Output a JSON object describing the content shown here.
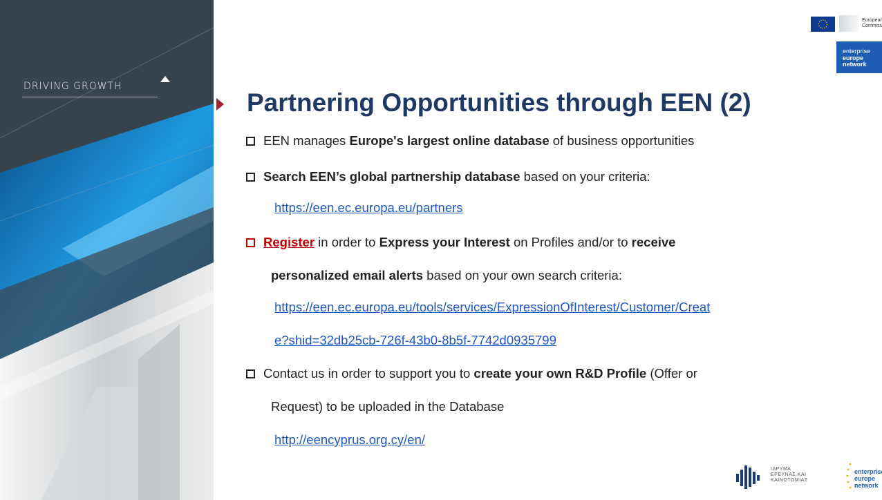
{
  "sidebar": {
    "tagline": "DRIVING GROWTH"
  },
  "logos": {
    "ec_text": "European\nCommission",
    "een_line1": "enterprise",
    "een_line2": "europe",
    "een_line3": "network",
    "ier_text": "ΙΔΡΥΜΑ\nΕΡΕΥΝΑΣ ΚΑΙ\nΚΑΙΝΟΤΟΜΙΑΣ",
    "een_small_line1": "enterprise",
    "een_small_line2": "europe",
    "een_small_line3": "network"
  },
  "title": "Partnering Opportunities through EEN (2)",
  "bullets": {
    "b1_pre": "EEN manages ",
    "b1_bold": "Europe's largest online database",
    "b1_post": " of business opportunities",
    "b2_bold": "Search EEN’s global partnership database",
    "b2_post": " based on your criteria:",
    "b2_link": "https://een.ec.europa.eu/partners",
    "b3_register": "Register",
    "b3_mid1": " in order to ",
    "b3_bold1": "Express your Interest",
    "b3_mid2": " on Profiles and/or to ",
    "b3_bold2": "receive",
    "b3_bold3": "personalized email alerts",
    "b3_post": " based on your  own search criteria:",
    "b3_link_line1": "https://een.ec.europa.eu/tools/services/ExpressionOfInterest/Customer/Creat",
    "b3_link_line2": "e?shid=32db25cb-726f-43b0-8b5f-7742d0935799",
    "b4_pre": "Contact us in order to support you to ",
    "b4_bold": "create your own R&D Profile",
    "b4_post": " (Offer or",
    "b4_line2": "Request) to be uploaded in the Database",
    "b4_link": "http://eencyprus.org.cy/en/"
  },
  "colors": {
    "title": "#1f3864",
    "link": "#1f57c3",
    "register": "#c00000",
    "accent_arrow": "#a31f34",
    "een_blue": "#1d5db6"
  }
}
